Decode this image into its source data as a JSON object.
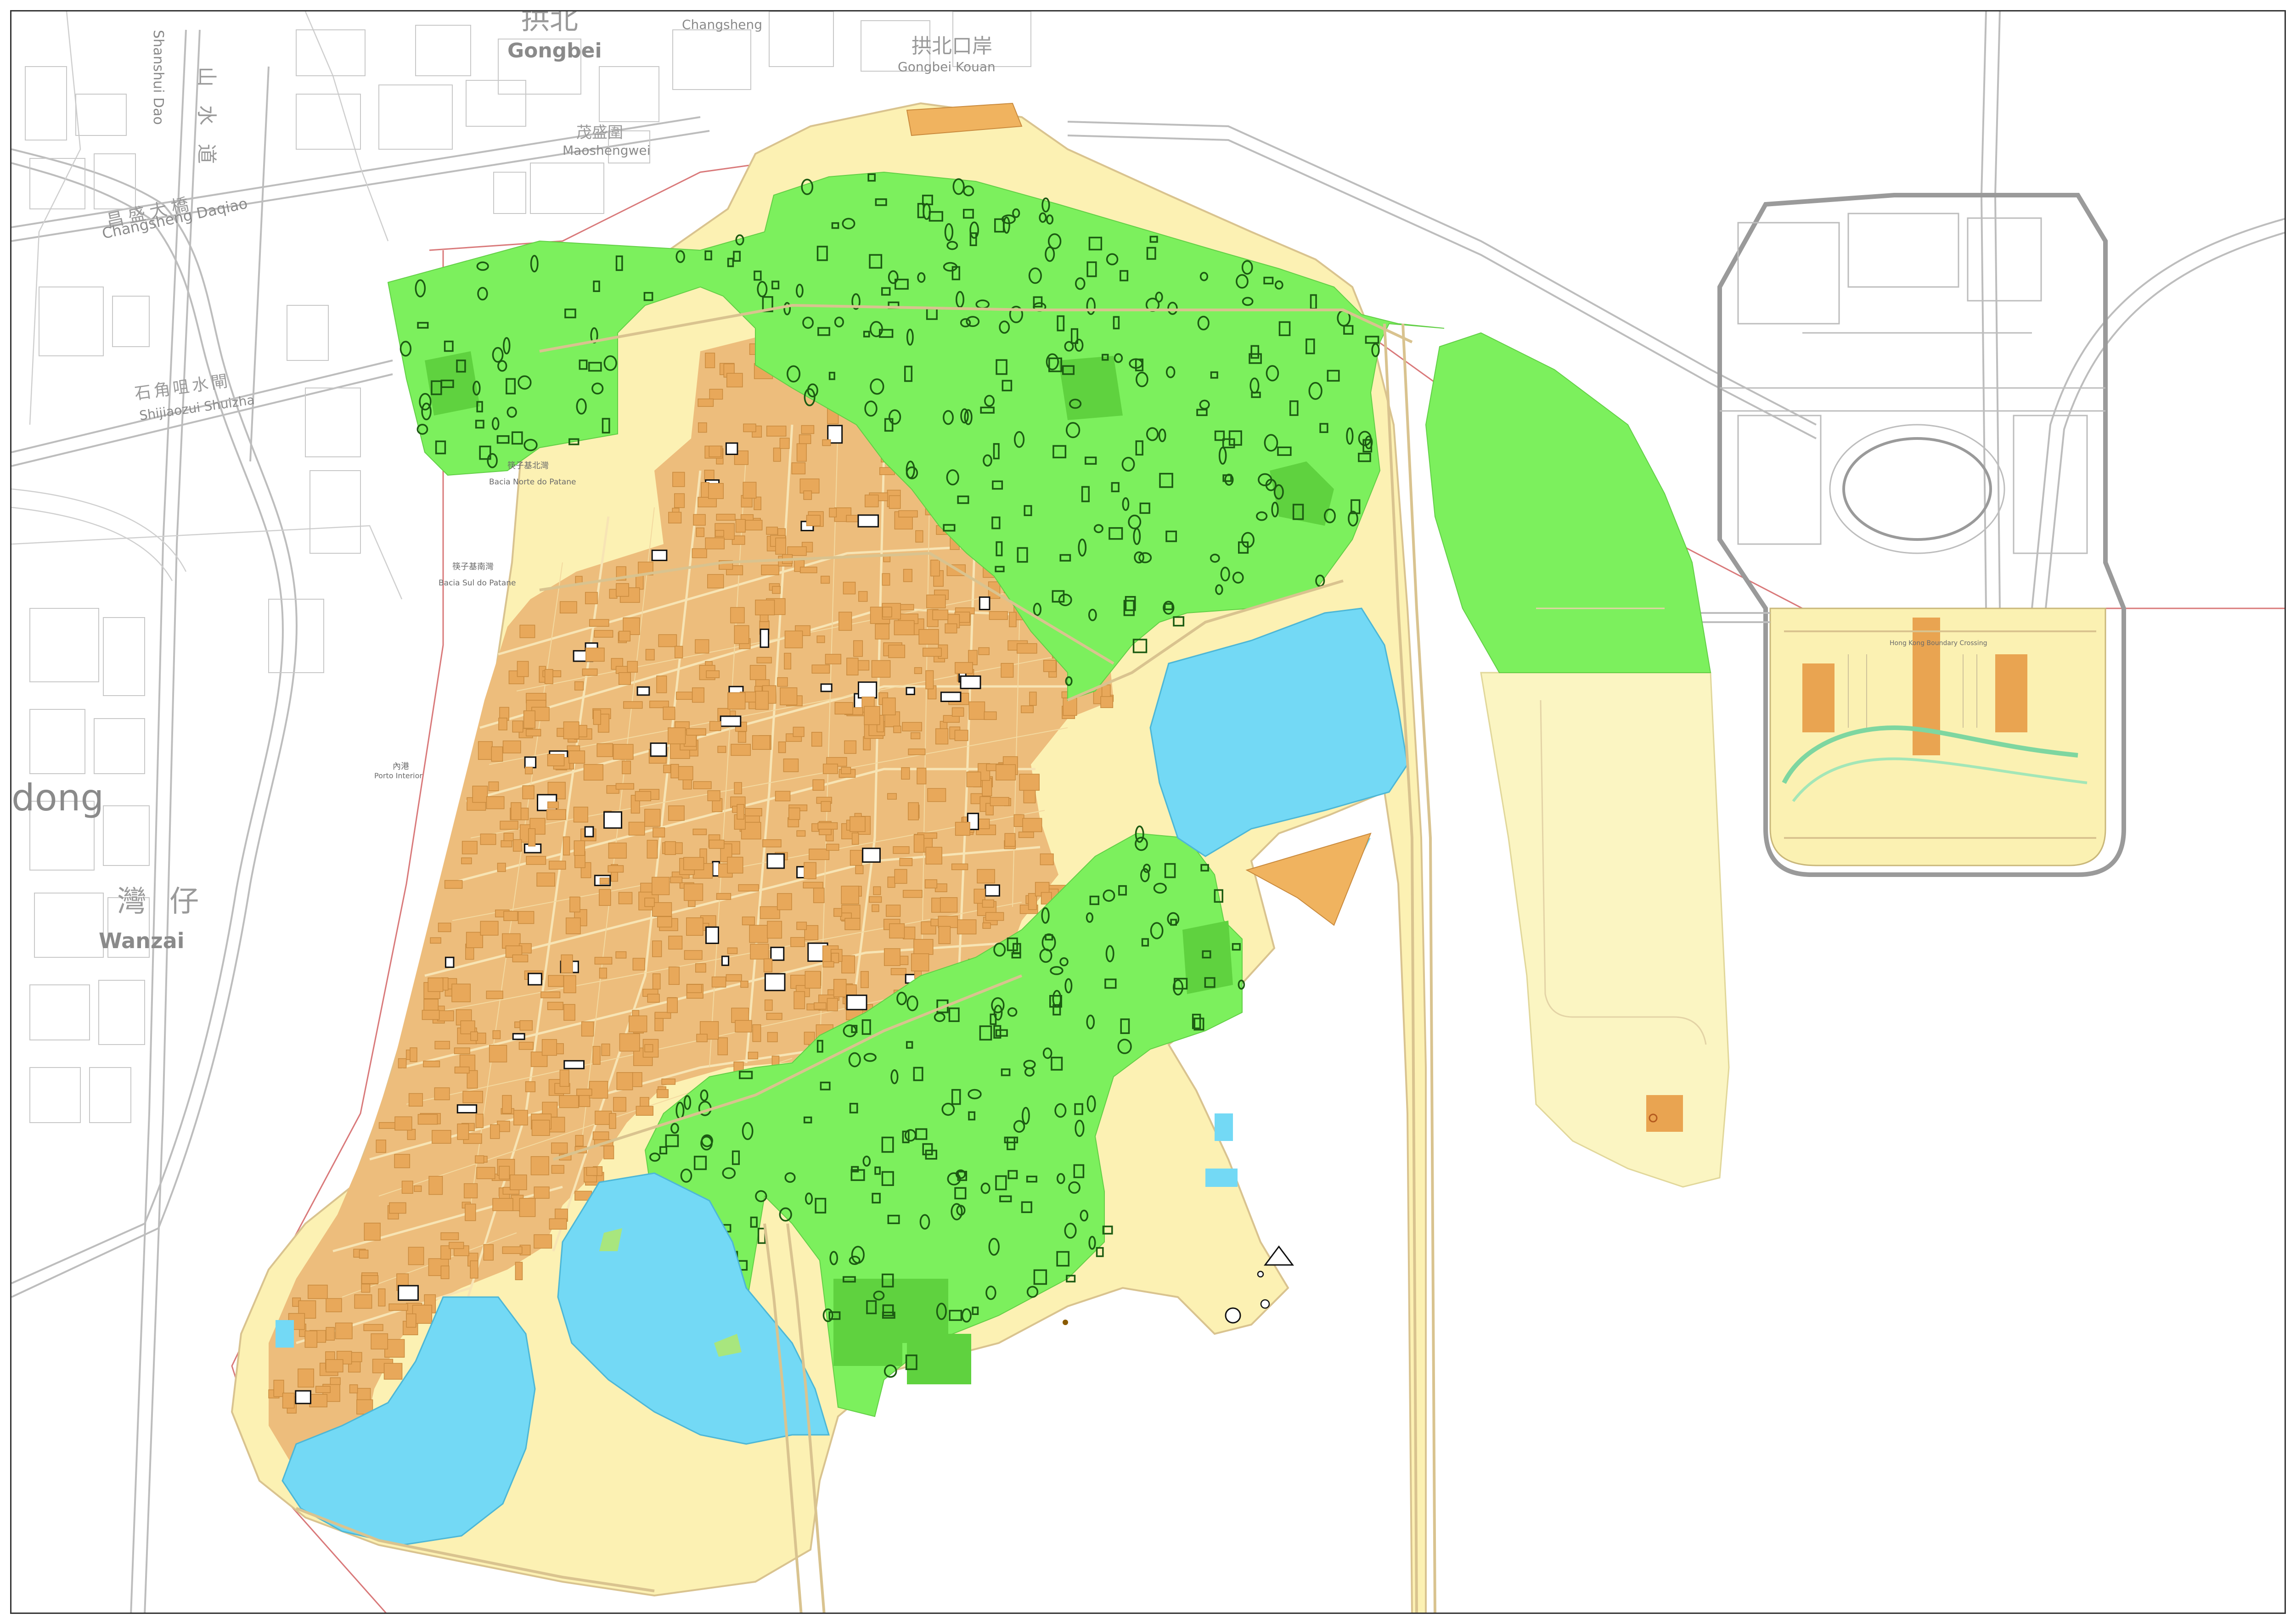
{
  "map": {
    "colors": {
      "land_base": "#fdf5b8",
      "urban_fill": "#edbd7c",
      "building": "#e8a85a",
      "green_zone": "#7cf05d",
      "green_dark": "#5fd23f",
      "water": "#73d9f5",
      "reclaim": "#fbf5c2",
      "neighbor_lines": "#bdbdbd",
      "border": "#d9797a"
    },
    "labels": {
      "gongbei_cn": "拱北",
      "gongbei_en": "Gongbei",
      "gongbei_kouan_cn": "拱北口岸",
      "gongbei_kouan_en": "Gongbei Kouan",
      "changsheng_en": "Changsheng",
      "maoshengwei_cn": "茂盛圍",
      "maoshengwei_en": "Maoshengwei",
      "shanshui_cn": "山水道",
      "shanshui_en": "Shanshui Dao",
      "changsheng_road_cn": "昌盛大橋",
      "changsheng_road_en": "Changsheng Daqiao",
      "shijiaozui_cn": "石角咀水閘",
      "shijiaozui_en": "Shijiaozui Shuizha",
      "wanzai_cn": "灣仔",
      "wanzai_en": "Wanzai",
      "dong_en": "dong",
      "basin_north_cn": "筷子基北灣",
      "basin_north_en": "Bacia Norte do Patane",
      "basin_south_cn": "筷子基南灣",
      "basin_south_en": "Bacia Sul do Patane",
      "porto_cn": "內港",
      "porto_en": "Porto Interior",
      "hk_port_en": "Hong Kong Boundary Crossing"
    },
    "icons": [
      "compass-marker-icon",
      "triangle-marker-icon"
    ]
  }
}
